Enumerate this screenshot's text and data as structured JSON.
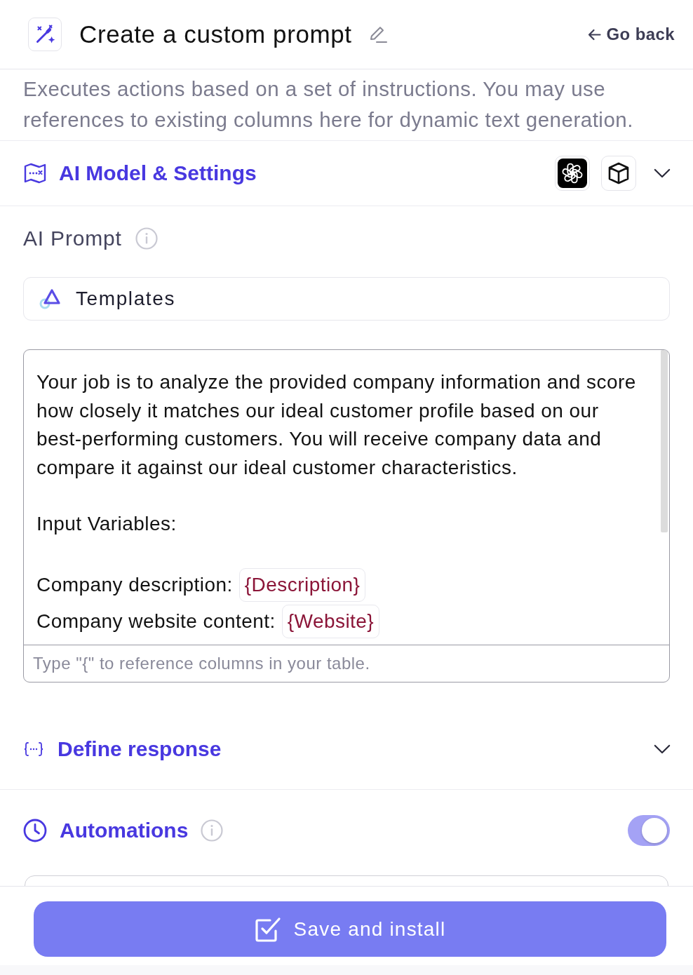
{
  "header": {
    "title": "Create a custom prompt",
    "back_link": "Go back"
  },
  "description": "Executes actions based on a set of instructions. You may use references to existing columns here for dynamic text generation.",
  "model_settings": {
    "title": "AI Model & Settings",
    "expanded": false
  },
  "prompt": {
    "label": "AI Prompt",
    "templates_button": "Templates",
    "blocks": [
      {
        "kind": "paragraph",
        "text": "Your job is to analyze the provided company information and score how closely it matches our ideal customer profile based on our best-performing customers. You will receive company data and compare it against our ideal customer characteristics."
      },
      {
        "kind": "paragraph",
        "text": "Input Variables:"
      },
      {
        "kind": "variable",
        "label": "Company description:",
        "variable": "{Description}"
      },
      {
        "kind": "variable",
        "label": "Company website content:",
        "variable": "{Website}"
      }
    ],
    "placeholder": "Type \"{\" to reference columns in your table."
  },
  "response": {
    "title": "Define response",
    "expanded": false
  },
  "automations": {
    "title": "Automations",
    "on": true
  },
  "save_button": "Save and install"
}
